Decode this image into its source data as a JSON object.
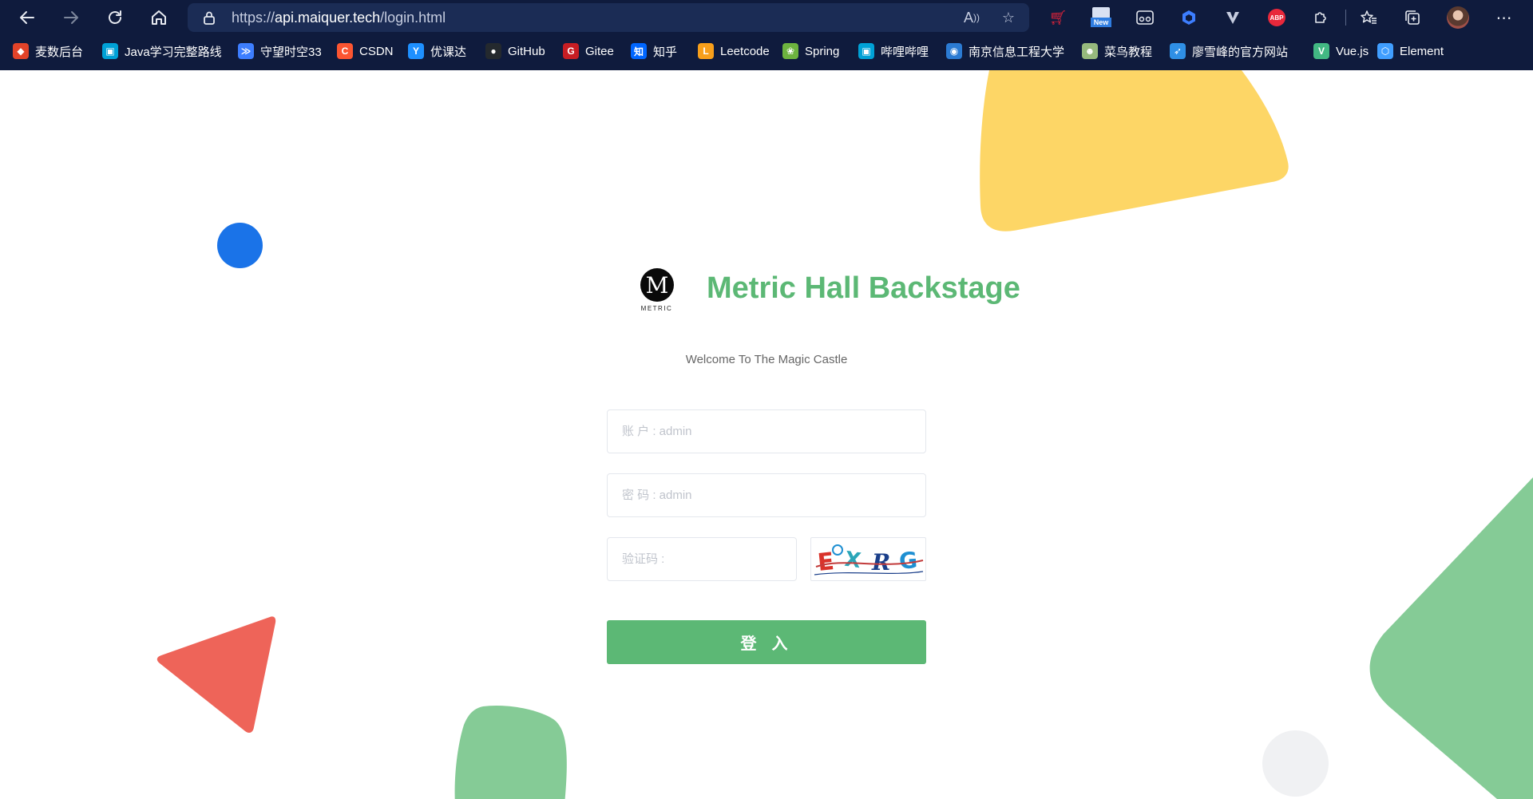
{
  "browser": {
    "url_prefix": "https://",
    "url_host": "api.maiquer.tech",
    "url_path": "/login.html",
    "new_badge": "New",
    "abp_badge": "ABP"
  },
  "bookmarks": [
    {
      "label": "麦数后台",
      "icon": "gitlab-icon",
      "color": "#e24329"
    },
    {
      "label": "Java学习完整路线",
      "icon": "bilibili-icon",
      "color": "#00a1d6"
    },
    {
      "label": "守望时空33",
      "icon": "chevrons-icon",
      "color": "#3d7eff"
    },
    {
      "label": "CSDN",
      "icon": "csdn-icon",
      "color": "#fc5531"
    },
    {
      "label": "优课达",
      "icon": "youkeda-icon",
      "color": "#1e90ff"
    },
    {
      "label": "GitHub",
      "icon": "github-icon",
      "color": "#24292e"
    },
    {
      "label": "Gitee",
      "icon": "gitee-icon",
      "color": "#c71d23"
    },
    {
      "label": "知乎",
      "icon": "zhihu-icon",
      "color": "#0066ff"
    },
    {
      "label": "Leetcode",
      "icon": "leetcode-icon",
      "color": "#f89f1b"
    },
    {
      "label": "Spring",
      "icon": "spring-icon",
      "color": "#6db33f"
    },
    {
      "label": "哔哩哔哩",
      "icon": "bilibili-icon",
      "color": "#00a1d6"
    },
    {
      "label": "南京信息工程大学",
      "icon": "university-icon",
      "color": "#2b7bd3"
    },
    {
      "label": "菜鸟教程",
      "icon": "runoob-icon",
      "color": "#96b97d"
    },
    {
      "label": "廖雪峰的官方网站",
      "icon": "rocket-icon",
      "color": "#2f8fe5"
    },
    {
      "label": "Vue.js",
      "icon": "vue-icon",
      "color": "#42b883"
    },
    {
      "label": "Element",
      "icon": "element-icon",
      "color": "#409eff"
    }
  ],
  "login": {
    "logo_letter": "M",
    "logo_text": "METRIC",
    "title": "Metric Hall Backstage",
    "subtitle": "Welcome To The Magic Castle",
    "account_placeholder": "账 户 : admin",
    "password_placeholder": "密 码 : admin",
    "captcha_placeholder": "验证码 :",
    "captcha_text": "EXRG",
    "submit_label": "登 入"
  },
  "colors": {
    "brand_green": "#5cb875",
    "yellow_shape": "#fdd666",
    "blue_dot": "#1a73e8",
    "red_triangle": "#ee6459",
    "green_shape": "#85cb96",
    "gray_circle": "#f0f1f3",
    "chrome_bg": "#0f1b3d"
  }
}
